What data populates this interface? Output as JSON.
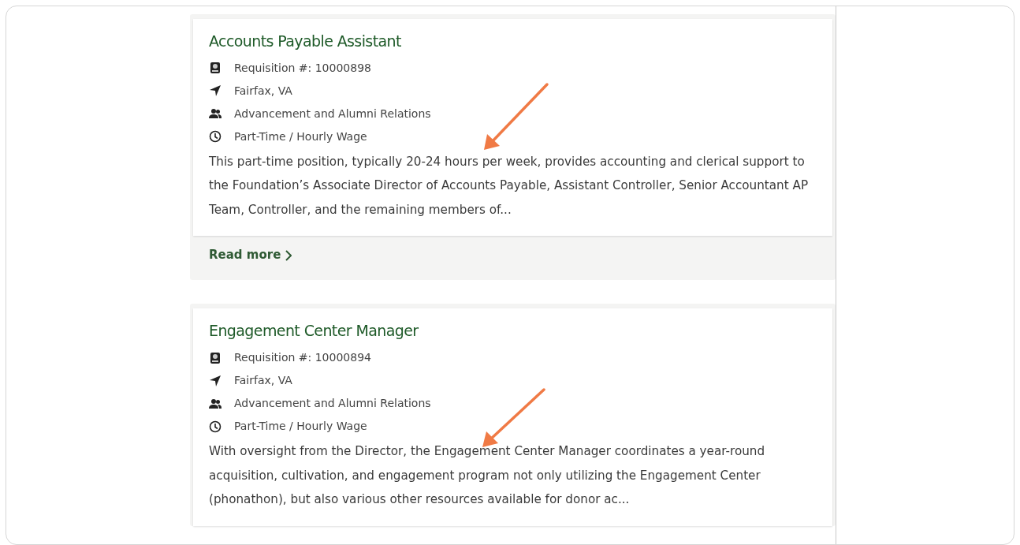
{
  "jobs": [
    {
      "title": "Accounts Payable Assistant",
      "details": [
        {
          "kind": "requisition",
          "text": "Requisition #: 10000898"
        },
        {
          "kind": "location",
          "text": "Fairfax, VA"
        },
        {
          "kind": "department",
          "text": "Advancement and Alumni Relations"
        },
        {
          "kind": "schedule",
          "text": "Part-Time / Hourly Wage"
        }
      ],
      "description": "This part-time position, typically 20-24 hours per week, provides accounting and clerical support to the Foundation’s Associate Director of Accounts Payable, Assistant Controller, Senior Accountant AP Team, Controller, and the remaining members of...",
      "link": "Read more"
    },
    {
      "title": "Engagement Center Manager",
      "details": [
        {
          "kind": "requisition",
          "text": "Requisition #: 10000894"
        },
        {
          "kind": "location",
          "text": "Fairfax, VA"
        },
        {
          "kind": "department",
          "text": "Advancement and Alumni Relations"
        },
        {
          "kind": "schedule",
          "text": "Part-Time / Hourly Wage"
        }
      ],
      "description": "With oversight from the Director, the Engagement Center Manager coordinates a year-round acquisition, cultivation, and engagement program not only utilizing the Engagement Center (phonathon), but also various other resources available for donor ac..."
    }
  ]
}
